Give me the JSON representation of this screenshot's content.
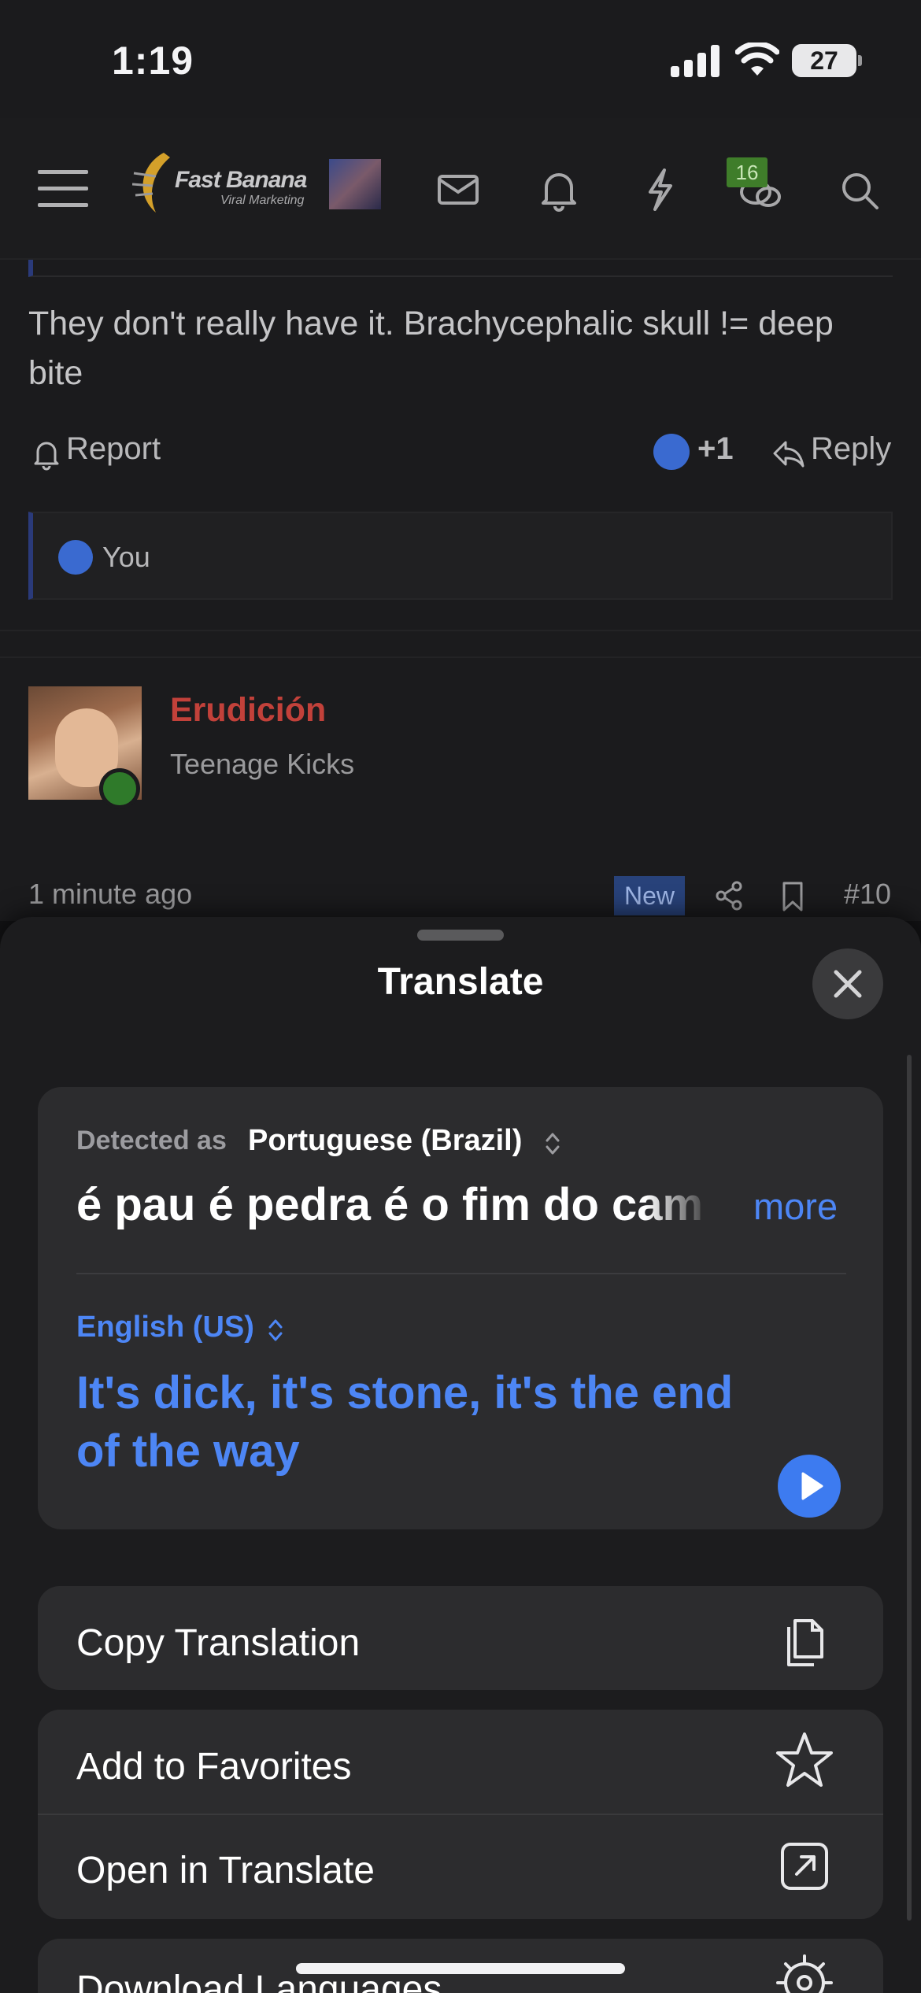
{
  "status_bar": {
    "time": "1:19",
    "battery": "27"
  },
  "forum_nav": {
    "brand": "Fast Banana",
    "brand_tagline": "Viral Marketing",
    "chat_badge": "16"
  },
  "post": {
    "text": "They don't really have it. Brachycephalic skull != deep bite",
    "report_label": "Report",
    "likes": "+1",
    "reply_label": "Reply",
    "reaction_user": "You"
  },
  "next_post": {
    "author": "Erudición",
    "author_title": "Teenage Kicks",
    "time": "1 minute ago",
    "new_badge": "New",
    "post_number": "#10"
  },
  "translate": {
    "title": "Translate",
    "detected_label": "Detected as",
    "source_language": "Portuguese (Brazil)",
    "source_text": "é pau é pedra é o fim do caminho",
    "more_label": "more",
    "target_language": "English (US)",
    "target_text": "It's dick, it's stone, it's the end of the way",
    "actions": {
      "copy": "Copy Translation",
      "favorites": "Add to Favorites",
      "open": "Open in Translate",
      "download": "Download Languages"
    }
  },
  "colors": {
    "accent_blue": "#4d86f5",
    "author_red": "#c2413a",
    "badge_green": "#3f7d2a",
    "sheet_bg": "#1c1c1e",
    "card_bg": "#2c2c2e"
  }
}
